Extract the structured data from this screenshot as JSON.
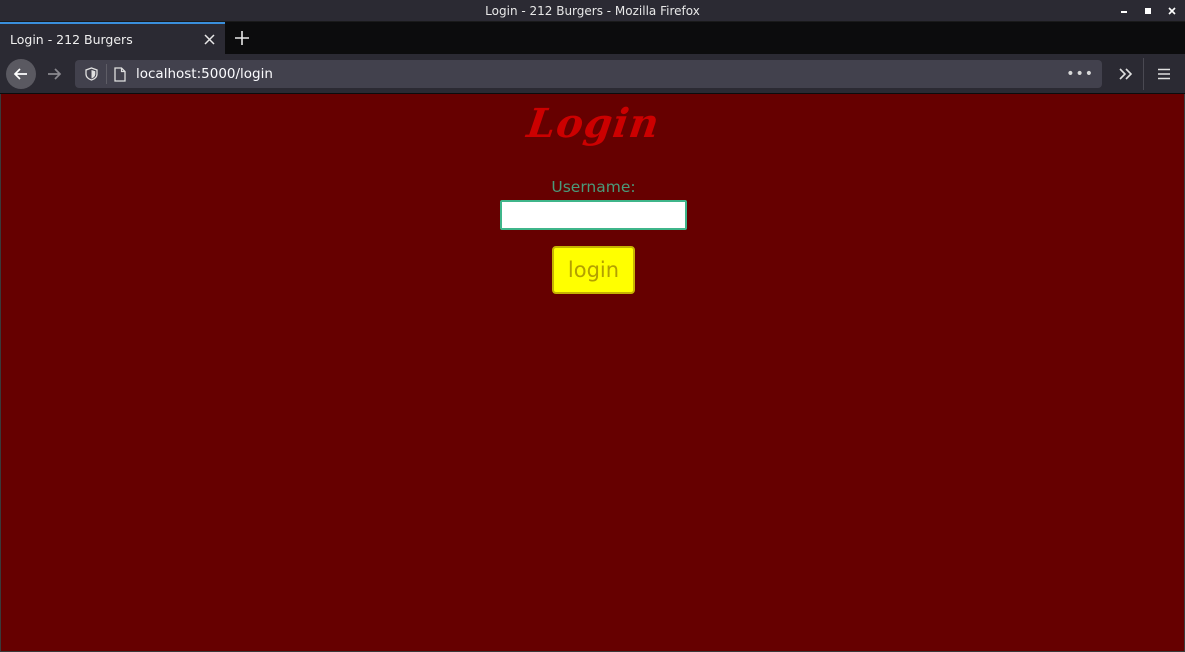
{
  "window": {
    "title": "Login - 212 Burgers - Mozilla Firefox"
  },
  "browser": {
    "tab_title": "Login - 212 Burgers",
    "url": "localhost:5000/login",
    "accent_color": "#3a8fdc"
  },
  "page": {
    "heading": "Login",
    "username_label": "Username:",
    "username_value": "",
    "login_button_label": "login",
    "background_color": "#660000",
    "heading_color": "#cc0000",
    "label_color": "#4a9a7a",
    "button_color": "#ffff00"
  },
  "icons": {
    "minimize": "minimize-icon",
    "maximize": "maximize-icon",
    "close": "close-icon",
    "tab_close": "close-icon",
    "new_tab": "plus-icon",
    "back": "arrow-left-icon",
    "forward": "arrow-right-icon",
    "tracking": "shield-icon",
    "page": "page-icon",
    "page_actions": "more-horizontal-icon",
    "overflow": "chevron-double-right-icon",
    "menu": "hamburger-menu-icon"
  }
}
